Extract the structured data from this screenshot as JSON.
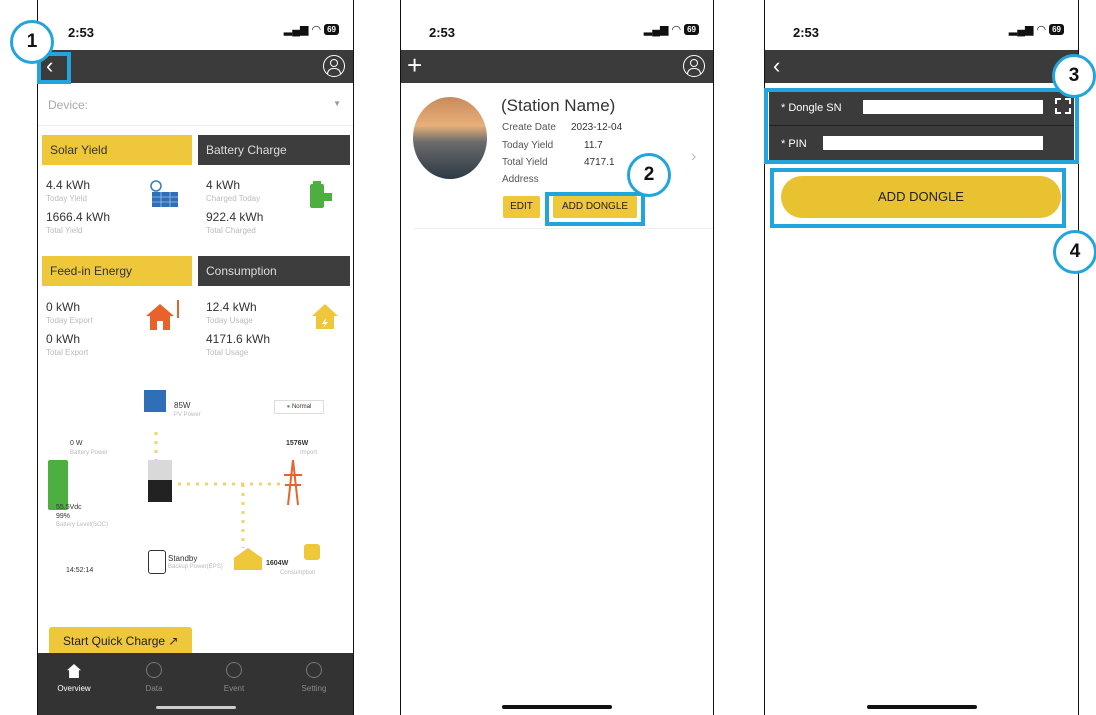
{
  "status": {
    "time": "2:53",
    "battery": "69"
  },
  "screen1": {
    "device_placeholder": "Device:",
    "cards": [
      {
        "title": "Solar Yield",
        "v1": "4.4 kWh",
        "l1": "Today Yield",
        "v2": "1666.4 kWh",
        "l2": "Total Yield"
      },
      {
        "title": "Battery Charge",
        "v1": "4 kWh",
        "l1": "Charged Today",
        "v2": "922.4 kWh",
        "l2": "Total Charged"
      },
      {
        "title": "Feed-in Energy",
        "v1": "0 kWh",
        "l1": "Today Export",
        "v2": "0 kWh",
        "l2": "Total Export"
      },
      {
        "title": "Consumption",
        "v1": "12.4 kWh",
        "l1": "Today Usage",
        "v2": "4171.6 kWh",
        "l2": "Total Usage"
      }
    ],
    "flow": {
      "pv_power": "85W",
      "pv_label": "PV Power",
      "status": "Normal",
      "battery_power": "0 W",
      "battery_power_label": "Battery Power",
      "import_power": "1576W",
      "import_label": "Import",
      "battery_voltage": "55.5Vdc",
      "soc": "99%",
      "soc_label": "Battery Level(SOC)",
      "eps_status": "Standby",
      "eps_label": "Backup Power(EPS)",
      "consumption_power": "1604W",
      "consumption_label": "Consumption",
      "time": "14:52:14"
    },
    "quick_charge": "Start Quick Charge ↗",
    "tabs": [
      "Overview",
      "Data",
      "Event",
      "Setting"
    ]
  },
  "screen2": {
    "station_name": "(Station Name)",
    "create_date_label": "Create Date",
    "create_date": "2023-12-04",
    "today_yield_label": "Today Yield",
    "today_yield": "11.7",
    "total_yield_label": "Total Yield",
    "total_yield": "4717.1",
    "address_label": "Address",
    "edit": "EDIT",
    "add_dongle": "ADD DONGLE"
  },
  "screen3": {
    "dongle_sn_label": "* Dongle SN",
    "dongle_sn_value": "",
    "pin_label": "* PIN",
    "pin_value": "",
    "add_dongle": "ADD DONGLE"
  },
  "callouts": [
    "1",
    "2",
    "3",
    "4"
  ],
  "colors": {
    "accent_yellow": "#efc73a",
    "header_dark": "#3b3b3b",
    "callout_blue": "#22a5dc"
  }
}
